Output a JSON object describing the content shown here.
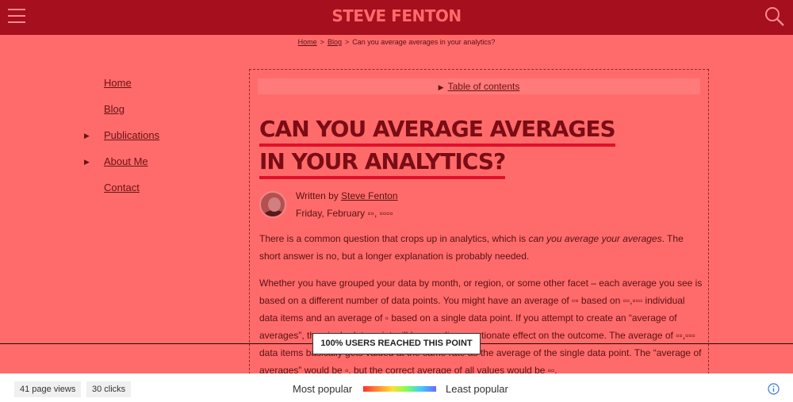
{
  "header": {
    "brand": "STEVE FENTON"
  },
  "breadcrumb": {
    "home": "Home",
    "blog": "Blog",
    "separator": ">",
    "current": "Can you average averages in your analytics?"
  },
  "sidenav": {
    "items": [
      {
        "label": "Home",
        "has_arrow": false
      },
      {
        "label": "Blog",
        "has_arrow": false
      },
      {
        "label": "Publications",
        "has_arrow": true
      },
      {
        "label": "About Me",
        "has_arrow": true
      },
      {
        "label": "Contact",
        "has_arrow": false
      }
    ],
    "arrow": "▶"
  },
  "article": {
    "toc_label": "Table of contents",
    "toc_arrow": "▶",
    "title_line1": "CAN YOU AVERAGE AVERAGES",
    "title_line2": "IN YOUR ANALYTICS?",
    "written_by": "Written by",
    "author": "Steve Fenton",
    "date": "Friday, February ▫▫, ▫▫▫▫",
    "p1_a": "There is a common question that crops up in analytics, which is ",
    "p1_em": "can you average your averages",
    "p1_b": ". The short answer is no, but a longer explanation is probably needed.",
    "p2": "Whether you have grouped your data by month, or region, or some other facet – each average you see is based on a different number of data points. You might have an average of ▫▫ based on ▫▫,▫▫▫ individual data items and an average of ▫ based on a single data point. If you attempt to create an “average of averages”, the single data point will have a disproportionate effect on the outcome. The average of ▫▫,▫▫▫ data items basically gets valued at the same rate as the average of the single data point. The “average of averages” would be ▫, but the correct average of all values would be ▫▫."
  },
  "heatmap": {
    "reach_label": "100% USERS REACHED THIS POINT",
    "page_views": "41 page views",
    "clicks": "30 clicks",
    "most_popular": "Most popular",
    "least_popular": "Least popular"
  },
  "colors": {
    "header": "#a50f1e",
    "overlay": "#ff6b6b",
    "accent": "#e0102a"
  },
  "icons": {
    "menu": "hamburger-icon",
    "search": "search-icon",
    "info": "info-icon"
  }
}
